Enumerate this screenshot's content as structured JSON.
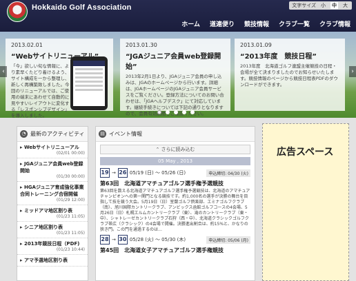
{
  "header": {
    "site_title": "Hokkaido Golf Association",
    "font_size_label": "文字サイズ",
    "font_sizes": [
      "小",
      "中",
      "大"
    ],
    "nav": [
      "ホーム",
      "道連便り",
      "競技情報",
      "クラブ一覧",
      "クラブ情報"
    ]
  },
  "hero": {
    "cards": [
      {
        "date": "2013.02.01",
        "title": "“Webサイトリニューアル”",
        "body": "「今」欲しい旬な情報に、より素早くたどり着けるよう、サイト構成を一から整理し、新しく再構築致しました。今回のリニューアルでは、ご使用の端末にあわせて自動的に見やすいレイアウトに変化する「レスポンシブデザイン」を導入しました。"
      },
      {
        "date": "2013.01.30",
        "title": "“JGAジュニア会員web登録開始”",
        "body": "2013年2月1日より、JGAジュニア会員の申し込みは、JGAのホームページから行います。詳細は、JGAホームページのJGAジュニア会員サービスをご覧ください。登録方法についてのお問い合わせは、「JGAヘルプデスク」にて対応しています。継続手続きについては下記の通りとなりますので、会員有効期間をご確認ください。"
      },
      {
        "date": "2013.01.09",
        "title": "“2013年度　競技日程”",
        "body": "2013年度　北海道ゴルフ連盟主催競技の日程・会場が全て決まりましたのでお知らせいたします。競技情報のページから競技日程表PDFのダウンロードができます。"
      }
    ],
    "prev_arrow": "‹",
    "next_arrow": "›"
  },
  "activity": {
    "heading": "最新のアクティビティ",
    "items": [
      {
        "title": "Webサイトリニューアル",
        "time": "(02/01 00:00)"
      },
      {
        "title": "JGAジュニア会員web登録開始",
        "time": "(01/30 00:00)"
      },
      {
        "title": "HGAジュニア育成強化事業合同トレーニング合宿開催",
        "time": "(01/29 12:00)"
      },
      {
        "title": "ミッドアマ地区割り表",
        "time": "(01/23 11:05)"
      },
      {
        "title": "シニア地区割り表",
        "time": "(01/23 11:05)"
      },
      {
        "title": "2013年競技日程（PDF)",
        "time": "(01/23 10:44)"
      },
      {
        "title": "アマ予選地区割り表",
        "time": ""
      }
    ]
  },
  "events": {
    "heading": "イベント情報",
    "load_more": "さらに読み込む",
    "day_label": "05 May , 2013",
    "items": [
      {
        "start_day": "19",
        "end_day": "26",
        "range": "05/19 (日) 〜 05/26 (日)",
        "deadline": "申込締切: 04/30 (火)",
        "title": "第63回　北海道アマチュアゴルフ選手権予選競技",
        "body": "第63回を数える北海道アマチュアゴルフ選手権予選競技は、北海道のアマチュアチャンピオンへの第一関門となる競技です。約1,000名の選手が決勝の舞台を目指して技を競う大会。5月19日（日）室蘭ゴルフ倶楽部、エミナゴルフクラブ（南）、旭川国際カントリークラブ、アンビックス函館ゴルフコースの4会場、5月26日（日）札幌エルムカントリークラブ（東）、滝のカントリークラブ（東・中）、シャトレーゼカントリークラブ石狩（西・中）、北海道クラシックゴルフクラブ帯広（クラシック）の4会場で開催。決勝進出割合は、約15%と、かなりの狭き門。この門を通過するのは…"
      },
      {
        "start_day": "28",
        "end_day": "30",
        "range": "05/28 (火) 〜 05/30 (木)",
        "deadline": "申込締切: 05/06 (月)",
        "title": "第45回　北海道女子アマチュアゴルフ選手権競技",
        "body": ""
      }
    ]
  },
  "ad": {
    "label": "広告スペース"
  }
}
